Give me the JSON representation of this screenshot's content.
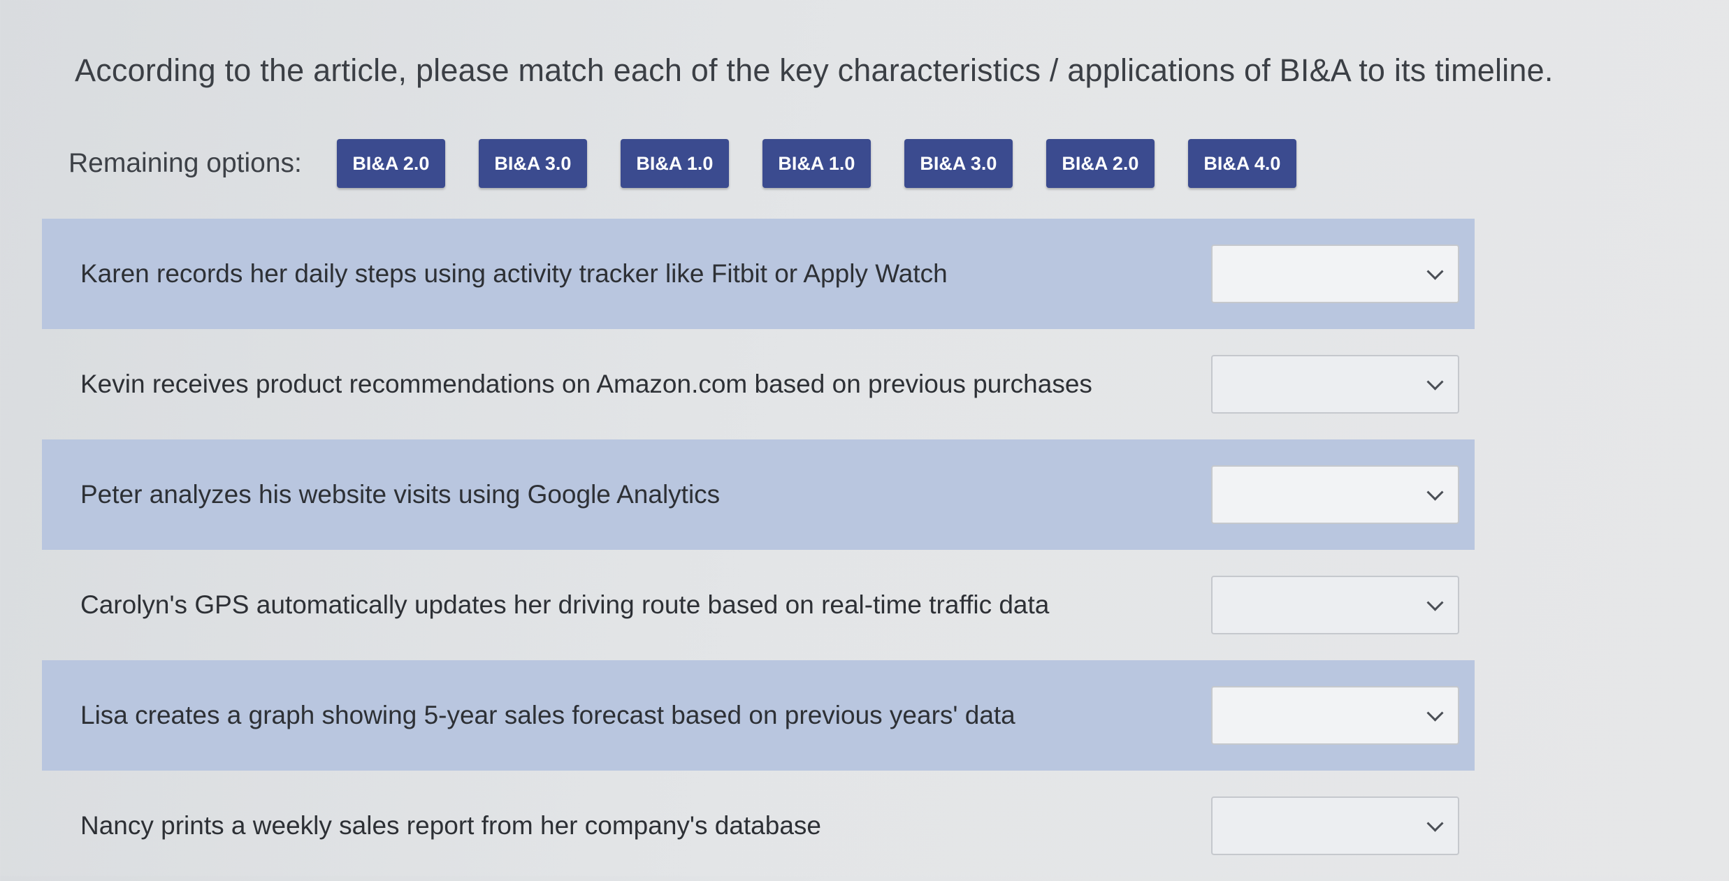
{
  "question": "According to the article, please match each of the key characteristics / applications of BI&A to its timeline.",
  "remaining_options_label": "Remaining options:",
  "options": [
    "BI&A 2.0",
    "BI&A 3.0",
    "BI&A 1.0",
    "BI&A 1.0",
    "BI&A 3.0",
    "BI&A 2.0",
    "BI&A 4.0"
  ],
  "items": [
    {
      "text": "Karen records her daily steps using activity tracker like Fitbit or Apply Watch",
      "selected": ""
    },
    {
      "text": "Kevin receives product recommendations on Amazon.com based on previous purchases",
      "selected": ""
    },
    {
      "text": "Peter analyzes his website visits using Google Analytics",
      "selected": ""
    },
    {
      "text": "Carolyn's GPS automatically updates her driving route based on real-time traffic data",
      "selected": ""
    },
    {
      "text": "Lisa creates a graph showing 5-year sales forecast based on previous years' data",
      "selected": ""
    },
    {
      "text": "Nancy prints a weekly sales report from her company's database",
      "selected": ""
    }
  ],
  "colors": {
    "chip": "#3b4b8f",
    "shaded_row": "#b9c6df"
  },
  "icons": {
    "dropdown": "chevron-down-icon"
  }
}
